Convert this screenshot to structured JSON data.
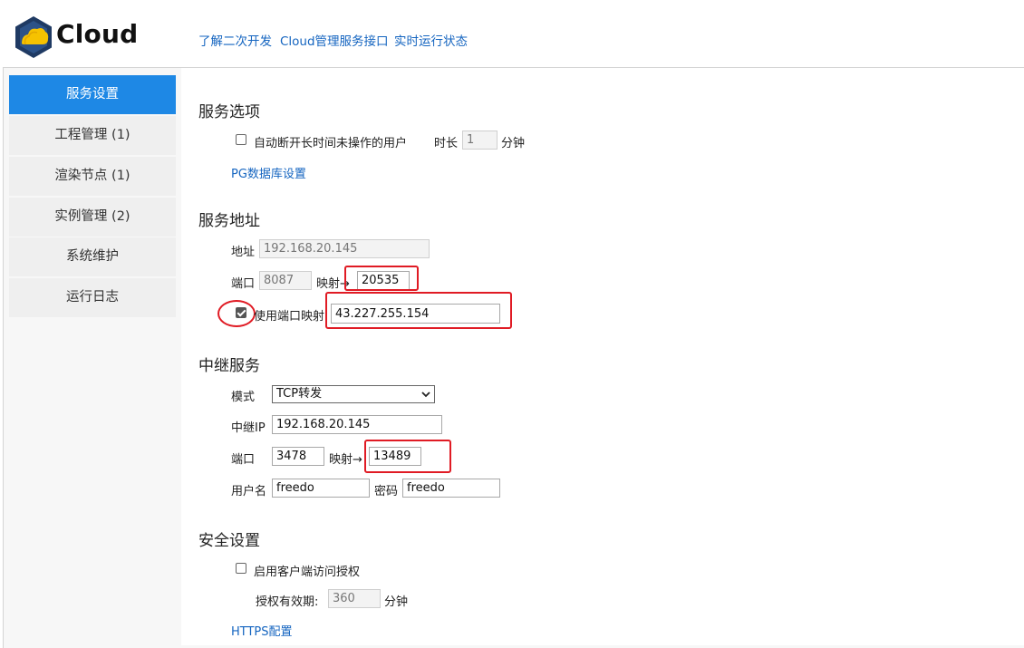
{
  "header": {
    "logo_text": "Cloud",
    "links": [
      "了解二次开发",
      "Cloud管理服务接口",
      "实时运行状态"
    ]
  },
  "sidebar": {
    "items": [
      {
        "label": "服务设置",
        "active": true
      },
      {
        "label": "工程管理 (1)"
      },
      {
        "label": "渲染节点 (1)"
      },
      {
        "label": "实例管理 (2)"
      },
      {
        "label": "系统维护"
      },
      {
        "label": "运行日志"
      }
    ]
  },
  "service_options": {
    "title": "服务选项",
    "auto_disconnect_label": "自动断开长时间未操作的用户",
    "auto_disconnect_checked": false,
    "duration_label": "时长",
    "duration_value": "1",
    "duration_unit": "分钟",
    "pg_link": "PG数据库设置"
  },
  "service_address": {
    "title": "服务地址",
    "address_label": "地址",
    "address_value": "192.168.20.145",
    "port_label": "端口",
    "port_value": "8087",
    "mapping_label": "映射→",
    "mapped_port_value": "20535",
    "use_mapping_label": "使用端口映射",
    "use_mapping_checked": true,
    "mapping_address_value": "43.227.255.154"
  },
  "relay": {
    "title": "中继服务",
    "mode_label": "模式",
    "mode_value": "TCP转发",
    "relay_ip_label": "中继IP",
    "relay_ip_value": "192.168.20.145",
    "port_label": "端口",
    "port_value": "3478",
    "mapping_label": "映射→",
    "mapped_port_value": "13489",
    "username_label": "用户名",
    "username_value": "freedo",
    "password_label": "密码",
    "password_value": "freedo"
  },
  "security": {
    "title": "安全设置",
    "client_auth_label": "启用客户端访问授权",
    "client_auth_checked": false,
    "auth_validity_label": "授权有效期:",
    "auth_validity_value": "360",
    "auth_validity_unit": "分钟",
    "https_link": "HTTPS配置"
  },
  "colors": {
    "accent": "#1e88e5",
    "link": "#1565c0",
    "annotation": "#e01b24"
  }
}
